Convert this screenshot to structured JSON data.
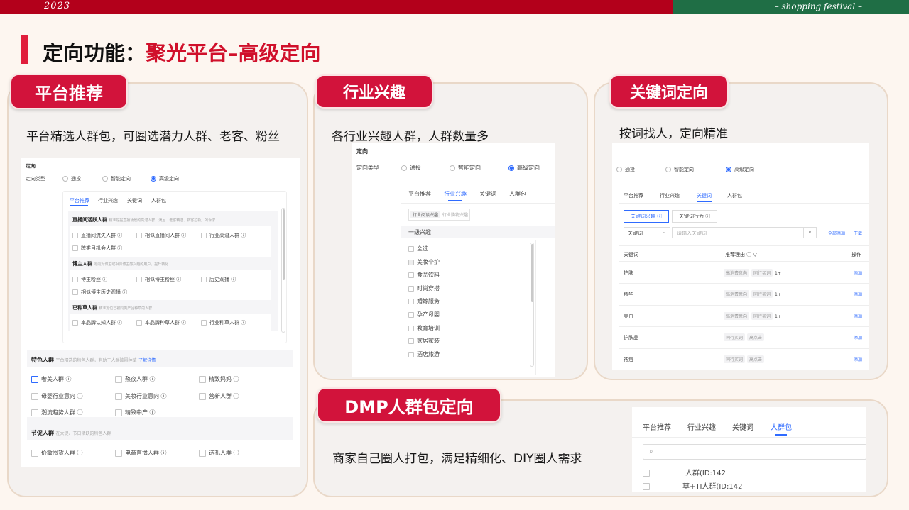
{
  "header": {
    "year": "2023",
    "festival": "– shopping festival –"
  },
  "page": {
    "title_black": "定向功能：",
    "title_red": "聚光平台–高级定向"
  },
  "cards": {
    "platform": {
      "tag": "平台推荐",
      "desc": "平台精选人群包，可圈选潜力人群、老客、粉丝"
    },
    "industry": {
      "tag": "行业兴趣",
      "desc": "各行业兴趣人群，人群数量多"
    },
    "keyword": {
      "tag": "关键词定向",
      "desc": "按词找人，定向精准"
    },
    "dmp": {
      "tag": "DMP人群包定向",
      "desc": "商家自己圈人打包，满足精细化、DIY圈人需求"
    }
  },
  "shot1": {
    "section": "定向",
    "type_label": "定向类型",
    "radios": [
      "通投",
      "智能定向",
      "高级定向"
    ],
    "tabs": [
      "平台推荐",
      "行业兴趣",
      "关键词",
      "人群包"
    ],
    "g1": {
      "title": "直播间活跃人群",
      "hint": "精准挖掘直播场景的高潜人群，满足「老客精选、新客拉新」的诉求",
      "items": [
        "直播间流失人群 ⓘ",
        "相似直播间人群 ⓘ",
        "行业高潜人群 ⓘ",
        "跨类目机会人群 ⓘ"
      ]
    },
    "g2": {
      "title": "博主人群",
      "hint": "定向对博主或相似博主感兴趣的用户，提升转化",
      "items": [
        "博主粉丝 ⓘ",
        "相似博主粉丝 ⓘ",
        "历史观播 ⓘ",
        "相似博主历史观播 ⓘ"
      ]
    },
    "g3": {
      "title": "已种草人群",
      "hint": "精准定位已被同类产品种草的人群",
      "items": [
        "本品牌认知人群 ⓘ",
        "本品牌种草人群 ⓘ",
        "行业种草人群 ⓘ"
      ]
    },
    "feature": {
      "title": "特色人群",
      "hint": "平台精选的特色人群，有助于人群破圈种草",
      "link": "了解详情",
      "items": [
        "奢美人群 ⓘ",
        "熬夜人群 ⓘ",
        "精致妈妈 ⓘ",
        "母婴行业意向 ⓘ",
        "美妆行业意向 ⓘ",
        "营新人群 ⓘ",
        "潮流趋势人群 ⓘ",
        "精致中产 ⓘ"
      ]
    },
    "promo": {
      "title": "节促人群",
      "hint": "在大促、节日活跃的特色人群",
      "items": [
        "价敏囤货人群 ⓘ",
        "电商直播人群 ⓘ",
        "送礼人群 ⓘ"
      ]
    }
  },
  "shot2": {
    "section": "定向",
    "type_label": "定向类型",
    "radios": [
      "通投",
      "智能定向",
      "高级定向"
    ],
    "tabs": [
      "平台推荐",
      "行业兴趣",
      "关键词",
      "人群包"
    ],
    "subtabs": [
      "行业阅读兴趣",
      "行业购物兴趣"
    ],
    "level": "一级兴趣",
    "items": [
      "全选",
      "美妆个护",
      "食品饮料",
      "时尚穿搭",
      "婚嫁服务",
      "孕产母婴",
      "教育培训",
      "家居家装",
      "酒店旅游"
    ]
  },
  "shot3": {
    "radios": [
      "通投",
      "智能定向",
      "高级定向"
    ],
    "tabs": [
      "平台推荐",
      "行业兴趣",
      "关键词",
      "人群包"
    ],
    "subtabs": [
      "关键词兴趣 ⓘ",
      "关键词行为 ⓘ"
    ],
    "select": "关键词",
    "placeholder": "请输入关键词",
    "add_all": "全部添加",
    "download": "下载",
    "columns": {
      "keyword": "关键词",
      "reason": "推荐理由 ⓘ ▽",
      "op": "操作"
    },
    "rows": [
      {
        "kw": "护肤",
        "tags": [
          "高消费意向",
          "同行买词",
          "1+"
        ],
        "op": "添加"
      },
      {
        "kw": "精华",
        "tags": [
          "高消费意向",
          "同行买词",
          "1+"
        ],
        "op": "添加"
      },
      {
        "kw": "美白",
        "tags": [
          "高消费意向",
          "同行买词",
          "1+"
        ],
        "op": "添加"
      },
      {
        "kw": "护肤品",
        "tags": [
          "同行买词",
          "高点击"
        ],
        "op": "添加"
      },
      {
        "kw": "祛痘",
        "tags": [
          "同行买词",
          "高点击"
        ],
        "op": "添加"
      }
    ]
  },
  "shot4": {
    "tabs": [
      "平台推荐",
      "行业兴趣",
      "关键词",
      "人群包"
    ],
    "rows": [
      "人群(ID:142",
      "草+TI人群(ID:142"
    ]
  }
}
